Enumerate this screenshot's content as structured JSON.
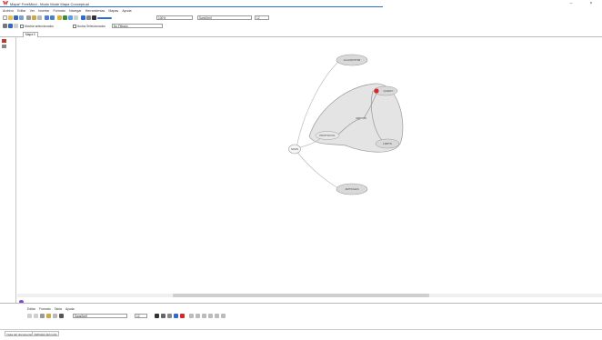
{
  "window": {
    "title": "Mapa*  FreeMind - Modo Mode Mapa Conceptual",
    "minimize": "–",
    "close": "×"
  },
  "menubar": [
    "Archivo",
    "Editar",
    "Ver",
    "Insertar",
    "Formato",
    "Navegar",
    "Herramientas",
    "Mapas",
    "Ayuda"
  ],
  "toolbar": {
    "zoom_value": "100%",
    "font_value": "SansSerif",
    "font_size": "12"
  },
  "toolbar2": {
    "show_label": "Mostrar seleccionados",
    "check_label": "Nodos Seleccionados",
    "filter_value": "No Filtrado"
  },
  "tab": {
    "label": "Mapa 0"
  },
  "mindmap": {
    "nodes": {
      "root": "MAIN",
      "top": "ALGORITHM",
      "left_mid": "PROTOCOL",
      "center": "ARROW",
      "right_top": "QUERY",
      "right_bottom": "LIMITS",
      "bottom": "ARTICLES"
    }
  },
  "notes_panel": {
    "menu": [
      "Editar",
      "Formato",
      "Tabla",
      "Ayuda"
    ],
    "font_value": "SansSerif",
    "size_value": "12",
    "tabs": [
      "Nota del documento",
      "Atributos del nodo"
    ]
  },
  "colors": {
    "accent": "#2a6bd6",
    "bubble_fill": "#e4e4e4",
    "bubble_stroke": "#9a9a9a",
    "node_fill": "#d9d9d9",
    "icon_red": "#d9262b"
  }
}
